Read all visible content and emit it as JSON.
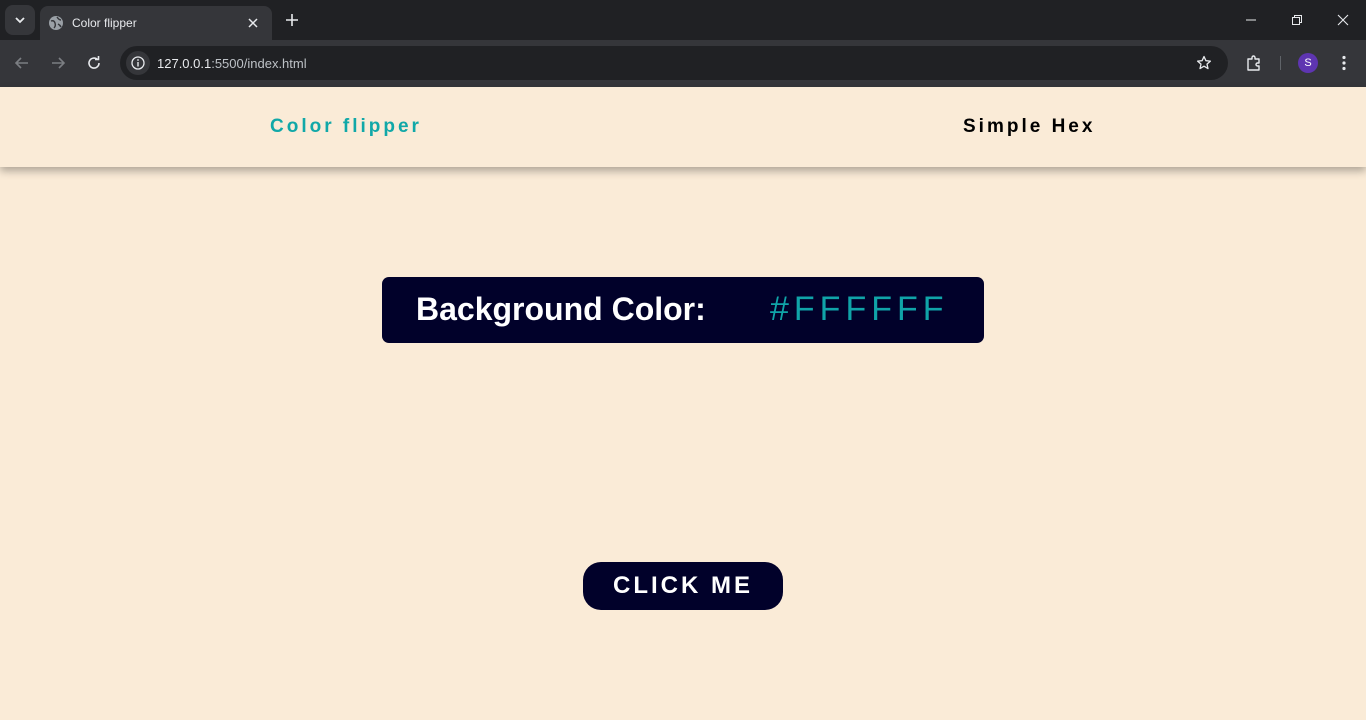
{
  "browser": {
    "tab_title": "Color flipper",
    "url_host": "127.0.0.1",
    "url_path": ":5500/index.html",
    "profile_initial": "S",
    "icons": {
      "tab_search": "chevron-down-icon",
      "favicon": "globe-icon",
      "tab_close": "close-icon",
      "new_tab": "plus-icon",
      "back": "arrow-left-icon",
      "forward": "arrow-right-icon",
      "reload": "reload-icon",
      "site_info": "info-icon",
      "bookmark": "star-icon",
      "extensions": "puzzle-icon",
      "menu": "kebab-icon"
    }
  },
  "page": {
    "navbar": {
      "brand": "Color flipper",
      "link": "Simple Hex"
    },
    "color_display": {
      "label": "Background Color:",
      "value": "#FFFFFF"
    },
    "button_label": "CLICK ME",
    "colors": {
      "background": "#faebd7",
      "accent": "#11a8a8",
      "dark_panel": "#01012a",
      "text_light": "#ffffff"
    }
  }
}
